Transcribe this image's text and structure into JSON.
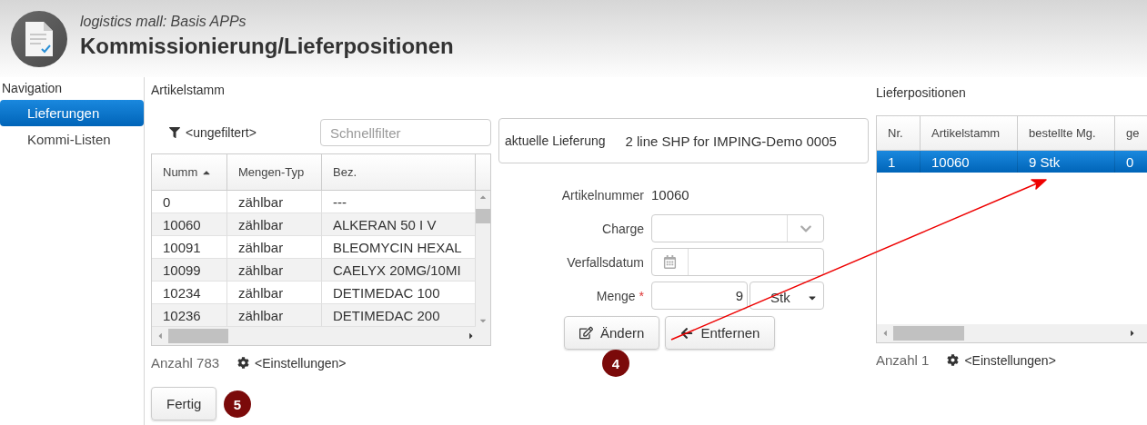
{
  "header": {
    "subtitle": "logistics mall: Basis APPs",
    "title": "Kommissionierung/Lieferpositionen"
  },
  "navigation": {
    "title": "Navigation",
    "items": [
      {
        "label": "Lieferungen",
        "selected": true
      },
      {
        "label": "Kommi-Listen",
        "selected": false
      }
    ]
  },
  "article_master": {
    "title": "Artikelstamm",
    "filter": "<ungefiltert>",
    "quick_filter": {
      "placeholder": "Schnellfilter"
    },
    "columns": [
      {
        "label": "Numm",
        "sorted": true
      },
      {
        "label": "Mengen-Typ",
        "sorted": false
      },
      {
        "label": "Bez.",
        "sorted": false
      }
    ],
    "rows": [
      [
        "0",
        "zählbar",
        "---"
      ],
      [
        "10060",
        "zählbar",
        "ALKERAN 50 I V"
      ],
      [
        "10091",
        "zählbar",
        "BLEOMYCIN HEXAL"
      ],
      [
        "10099",
        "zählbar",
        "CAELYX 20MG/10MI"
      ],
      [
        "10234",
        "zählbar",
        "DETIMEDAC 100"
      ],
      [
        "10236",
        "zählbar",
        "DETIMEDAC 200"
      ]
    ],
    "count_label": "Anzahl",
    "count": "783",
    "settings": "<Einstellungen>"
  },
  "done_button": {
    "label": "Fertig",
    "annotation": "5"
  },
  "current_delivery": {
    "label": "aktuelle Lieferung",
    "value": "2 line SHP for IMPING-Demo 0005"
  },
  "form": {
    "article_number": {
      "label": "Artikelnummer",
      "value": "10060"
    },
    "batch": {
      "label": "Charge"
    },
    "expiry": {
      "label": "Verfallsdatum"
    },
    "quantity": {
      "label": "Menge",
      "required_mark": "*",
      "value": "9",
      "unit": "Stk"
    }
  },
  "buttons": [
    {
      "kind": "edit",
      "label": "Ändern",
      "annotation": "4"
    },
    {
      "kind": "remove",
      "label": "Entfernen"
    }
  ],
  "delivery_positions": {
    "title": "Lieferpositionen",
    "columns": [
      "Nr.",
      "Artikelstamm",
      "bestellte Mg.",
      "ge"
    ],
    "rows": [
      {
        "cells": [
          "1",
          "10060",
          "9 Stk",
          "0"
        ],
        "selected": true
      }
    ],
    "count_label": "Anzahl",
    "count": "1",
    "settings": "<Einstellungen>"
  }
}
